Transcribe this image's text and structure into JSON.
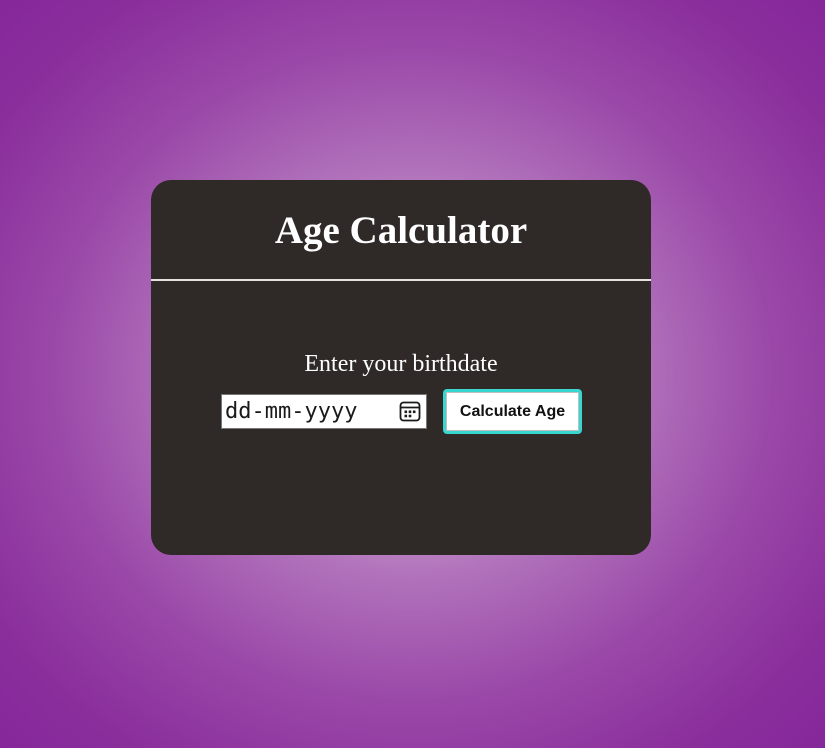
{
  "calculator": {
    "title": "Age Calculator",
    "prompt": "Enter your birthdate",
    "date_input": {
      "placeholder": "dd-mm-yyyy",
      "icon": "calendar-icon"
    },
    "calculate_button_label": "Calculate Age"
  },
  "colors": {
    "background_center": "#f2e6f0",
    "background_edge": "#85279a",
    "card": "#2f2927",
    "button_border": "#37d6cf"
  }
}
